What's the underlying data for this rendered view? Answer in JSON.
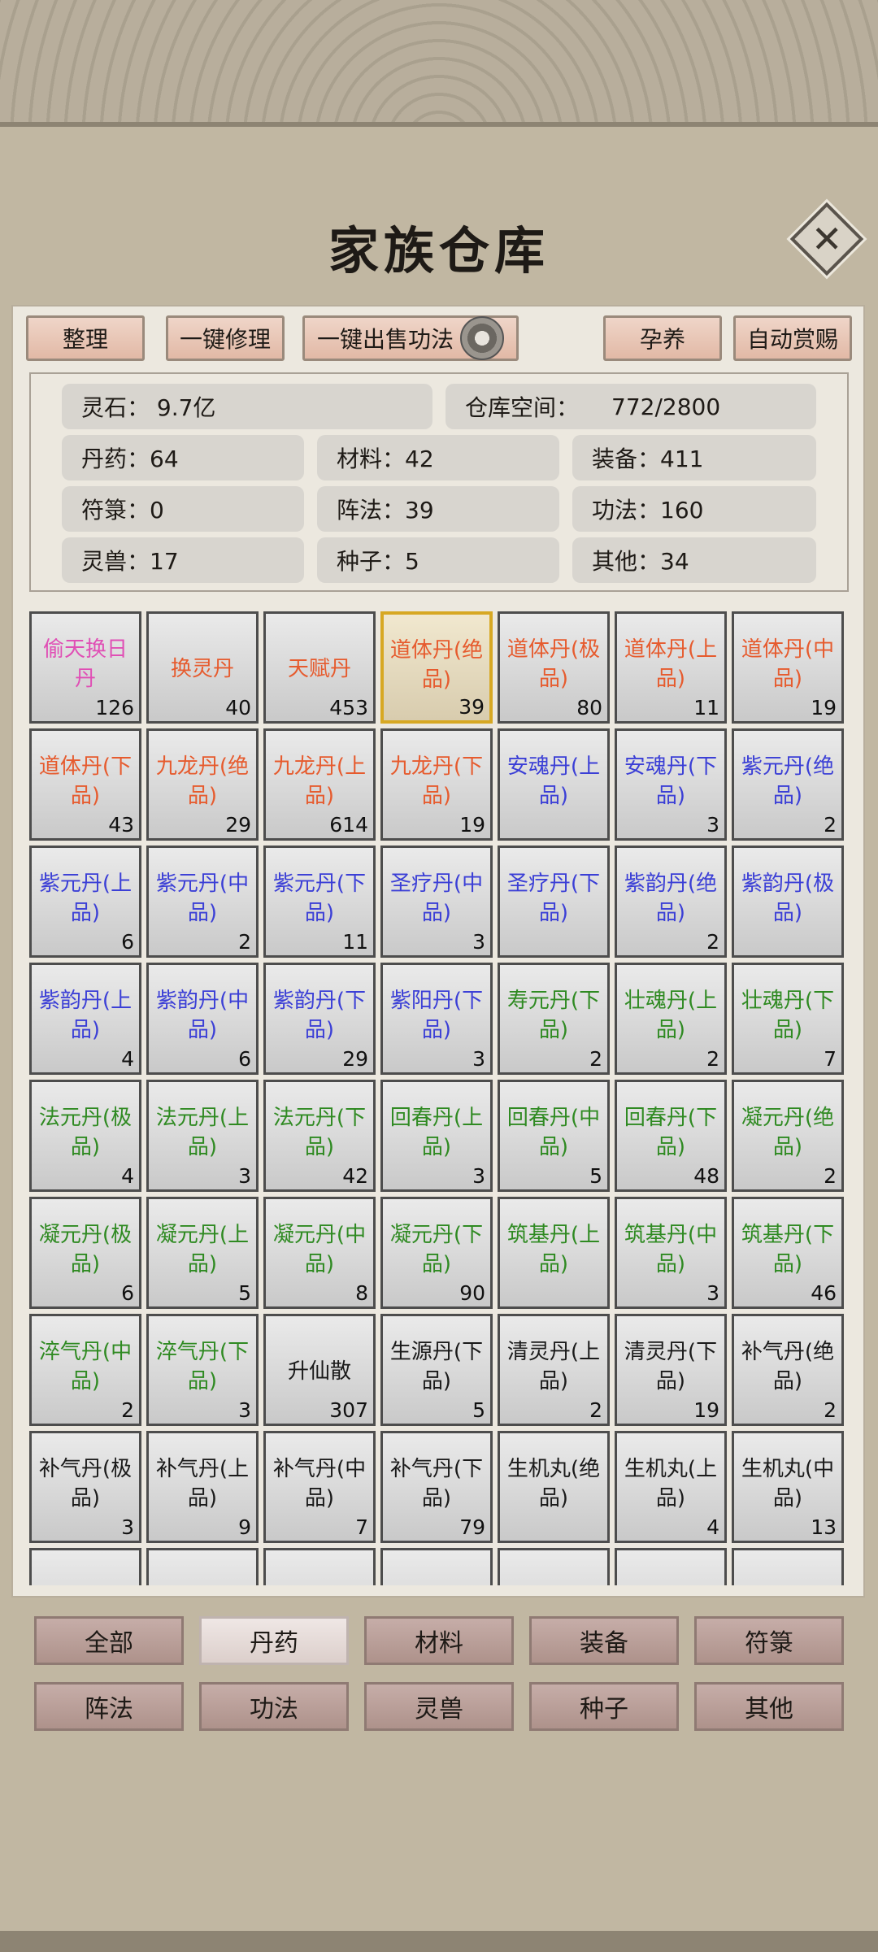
{
  "title": "家族仓库",
  "toolbar": {
    "tidy": "整理",
    "repair_all": "一键修理",
    "sell_skills": "一键出售功法",
    "nurture": "孕养",
    "auto_reward": "自动赏赐"
  },
  "stats": {
    "spirit_stone": "灵石：  9.7亿",
    "capacity_label": "仓库空间：",
    "capacity_value": "772/2800",
    "pills": "丹药：64",
    "materials": "材料：42",
    "equipment": "装备：411",
    "talismans": "符箓：0",
    "formations": "阵法：39",
    "skills": "功法：160",
    "beasts": "灵兽：17",
    "seeds": "种子：5",
    "others": "其他：34"
  },
  "colors": {
    "pink": "#e04fb5",
    "orange": "#e65b2e",
    "blue": "#3b3fd6",
    "green": "#2f8a22",
    "black": "#1a1a1a"
  },
  "items": [
    {
      "name": "偷天换日丹",
      "count": "126",
      "color": "pink"
    },
    {
      "name": "换灵丹",
      "count": "40",
      "color": "orange"
    },
    {
      "name": "天赋丹",
      "count": "453",
      "color": "orange"
    },
    {
      "name": "道体丹(绝品)",
      "count": "39",
      "color": "orange",
      "selected": true
    },
    {
      "name": "道体丹(极品)",
      "count": "80",
      "color": "orange"
    },
    {
      "name": "道体丹(上品)",
      "count": "11",
      "color": "orange"
    },
    {
      "name": "道体丹(中品)",
      "count": "19",
      "color": "orange"
    },
    {
      "name": "道体丹(下品)",
      "count": "43",
      "color": "orange"
    },
    {
      "name": "九龙丹(绝品)",
      "count": "29",
      "color": "orange"
    },
    {
      "name": "九龙丹(上品)",
      "count": "614",
      "color": "orange"
    },
    {
      "name": "九龙丹(下品)",
      "count": "19",
      "color": "orange"
    },
    {
      "name": "安魂丹(上品)",
      "count": "",
      "color": "blue"
    },
    {
      "name": "安魂丹(下品)",
      "count": "3",
      "color": "blue"
    },
    {
      "name": "紫元丹(绝品)",
      "count": "2",
      "color": "blue"
    },
    {
      "name": "紫元丹(上品)",
      "count": "6",
      "color": "blue"
    },
    {
      "name": "紫元丹(中品)",
      "count": "2",
      "color": "blue"
    },
    {
      "name": "紫元丹(下品)",
      "count": "11",
      "color": "blue"
    },
    {
      "name": "圣疗丹(中品)",
      "count": "3",
      "color": "blue"
    },
    {
      "name": "圣疗丹(下品)",
      "count": "",
      "color": "blue"
    },
    {
      "name": "紫韵丹(绝品)",
      "count": "2",
      "color": "blue"
    },
    {
      "name": "紫韵丹(极品)",
      "count": "",
      "color": "blue"
    },
    {
      "name": "紫韵丹(上品)",
      "count": "4",
      "color": "blue"
    },
    {
      "name": "紫韵丹(中品)",
      "count": "6",
      "color": "blue"
    },
    {
      "name": "紫韵丹(下品)",
      "count": "29",
      "color": "blue"
    },
    {
      "name": "紫阳丹(下品)",
      "count": "3",
      "color": "blue"
    },
    {
      "name": "寿元丹(下品)",
      "count": "2",
      "color": "green"
    },
    {
      "name": "壮魂丹(上品)",
      "count": "2",
      "color": "green"
    },
    {
      "name": "壮魂丹(下品)",
      "count": "7",
      "color": "green"
    },
    {
      "name": "法元丹(极品)",
      "count": "4",
      "color": "green"
    },
    {
      "name": "法元丹(上品)",
      "count": "3",
      "color": "green"
    },
    {
      "name": "法元丹(下品)",
      "count": "42",
      "color": "green"
    },
    {
      "name": "回春丹(上品)",
      "count": "3",
      "color": "green"
    },
    {
      "name": "回春丹(中品)",
      "count": "5",
      "color": "green"
    },
    {
      "name": "回春丹(下品)",
      "count": "48",
      "color": "green"
    },
    {
      "name": "凝元丹(绝品)",
      "count": "2",
      "color": "green"
    },
    {
      "name": "凝元丹(极品)",
      "count": "6",
      "color": "green"
    },
    {
      "name": "凝元丹(上品)",
      "count": "5",
      "color": "green"
    },
    {
      "name": "凝元丹(中品)",
      "count": "8",
      "color": "green"
    },
    {
      "name": "凝元丹(下品)",
      "count": "90",
      "color": "green"
    },
    {
      "name": "筑基丹(上品)",
      "count": "",
      "color": "green"
    },
    {
      "name": "筑基丹(中品)",
      "count": "3",
      "color": "green"
    },
    {
      "name": "筑基丹(下品)",
      "count": "46",
      "color": "green"
    },
    {
      "name": "淬气丹(中品)",
      "count": "2",
      "color": "green"
    },
    {
      "name": "淬气丹(下品)",
      "count": "3",
      "color": "green"
    },
    {
      "name": "升仙散",
      "count": "307",
      "color": "black"
    },
    {
      "name": "生源丹(下品)",
      "count": "5",
      "color": "black"
    },
    {
      "name": "清灵丹(上品)",
      "count": "2",
      "color": "black"
    },
    {
      "name": "清灵丹(下品)",
      "count": "19",
      "color": "black"
    },
    {
      "name": "补气丹(绝品)",
      "count": "2",
      "color": "black"
    },
    {
      "name": "补气丹(极品)",
      "count": "3",
      "color": "black"
    },
    {
      "name": "补气丹(上品)",
      "count": "9",
      "color": "black"
    },
    {
      "name": "补气丹(中品)",
      "count": "7",
      "color": "black"
    },
    {
      "name": "补气丹(下品)",
      "count": "79",
      "color": "black"
    },
    {
      "name": "生机丸(绝品)",
      "count": "",
      "color": "black"
    },
    {
      "name": "生机丸(上品)",
      "count": "4",
      "color": "black"
    },
    {
      "name": "生机丸(中品)",
      "count": "13",
      "color": "black"
    },
    {
      "name": "",
      "count": "",
      "color": "black"
    },
    {
      "name": "",
      "count": "",
      "color": "black"
    },
    {
      "name": "",
      "count": "",
      "color": "black"
    },
    {
      "name": "",
      "count": "",
      "color": "black"
    },
    {
      "name": "",
      "count": "",
      "color": "black"
    },
    {
      "name": "",
      "count": "",
      "color": "black"
    },
    {
      "name": "",
      "count": "",
      "color": "black"
    }
  ],
  "tabs": [
    {
      "label": "全部"
    },
    {
      "label": "丹药",
      "active": true
    },
    {
      "label": "材料"
    },
    {
      "label": "装备"
    },
    {
      "label": "符箓"
    },
    {
      "label": "阵法"
    },
    {
      "label": "功法"
    },
    {
      "label": "灵兽"
    },
    {
      "label": "种子"
    },
    {
      "label": "其他"
    }
  ]
}
